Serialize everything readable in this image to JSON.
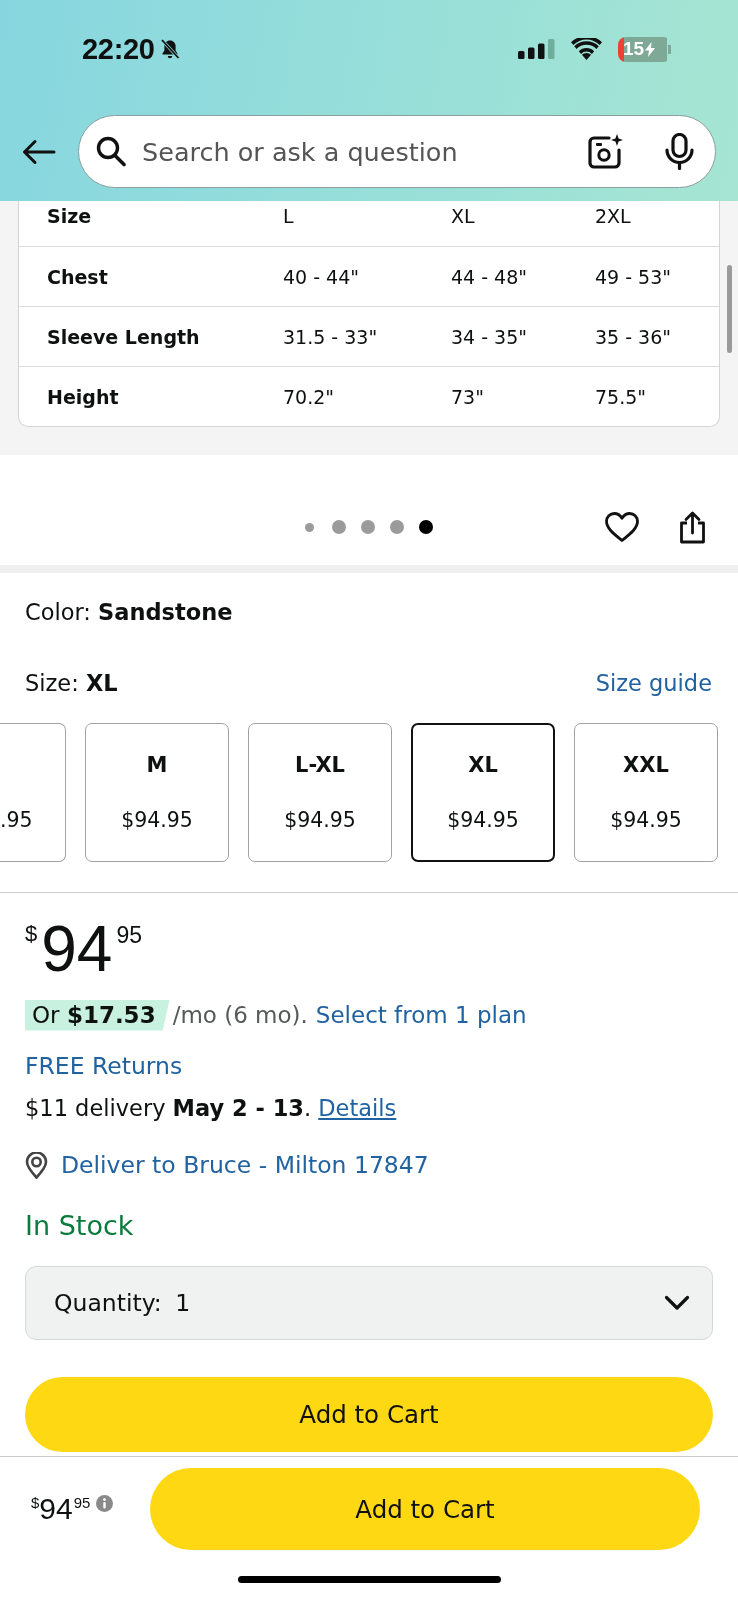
{
  "status_bar": {
    "time": "22:20",
    "battery": "15"
  },
  "search": {
    "placeholder": "Search or ask a question"
  },
  "size_chart": {
    "rows": [
      {
        "label": "Size",
        "cells": [
          "L",
          "XL",
          "2XL"
        ]
      },
      {
        "label": "Chest",
        "cells": [
          "40 - 44\"",
          "44 - 48\"",
          "49 - 53\""
        ]
      },
      {
        "label": "Sleeve Length",
        "cells": [
          "31.5 - 33\"",
          "34 - 35\"",
          "35 - 36\""
        ]
      },
      {
        "label": "Height",
        "cells": [
          "70.2\"",
          "73\"",
          "75.5\""
        ]
      }
    ]
  },
  "image_pager": {
    "dots": [
      {
        "kind": "edge",
        "selected": false
      },
      {
        "kind": "page",
        "selected": false
      },
      {
        "kind": "page",
        "selected": false
      },
      {
        "kind": "page",
        "selected": false
      },
      {
        "kind": "page",
        "selected": true
      }
    ]
  },
  "color": {
    "label": "Color:",
    "value": "Sandstone"
  },
  "size": {
    "label": "Size:",
    "value": "XL",
    "guide_link": "Size guide"
  },
  "size_options": [
    {
      "price": ".95",
      "selected": false
    },
    {
      "label": "M",
      "price": "$94.95",
      "selected": false
    },
    {
      "label": "L-XL",
      "price": "$94.95",
      "selected": false
    },
    {
      "label": "XL",
      "price": "$94.95",
      "selected": true
    },
    {
      "label": "XXL",
      "price": "$94.95",
      "selected": false
    }
  ],
  "price": {
    "symbol": "$",
    "whole": "94",
    "fraction": "95"
  },
  "installment": {
    "offer": "Or **$17.53**",
    "terms": "/mo (6 mo).",
    "link": "Select from 1 plan"
  },
  "returns": "FREE Returns",
  "delivery": {
    "text": "$11 delivery **May 2 - 13**.",
    "link": "Details"
  },
  "deliver_to": "Deliver to Bruce - Milton 17847",
  "availability": "In Stock",
  "quantity": {
    "label": "Quantity:",
    "value": "1"
  },
  "add_to_cart": "Add to Cart",
  "sticky_bar": {
    "price": {
      "symbol": "$",
      "whole": "94",
      "fraction": "95"
    },
    "button": "Add to Cart"
  }
}
